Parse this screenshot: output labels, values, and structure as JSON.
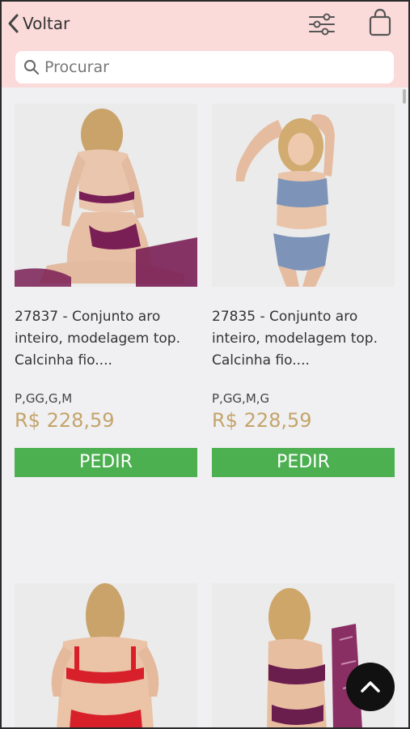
{
  "header": {
    "back_label": "Voltar",
    "filter_icon": "sliders-icon",
    "bag_icon": "shopping-bag-icon"
  },
  "search": {
    "placeholder": "Procurar",
    "icon": "search-icon"
  },
  "products": [
    {
      "title": "27837 - Conjunto aro inteiro, modelagem top. Calcinha fio....",
      "sizes": "P,GG,G,M",
      "price": "R$ 228,59",
      "button": "PEDIR",
      "color": "#7a1f55"
    },
    {
      "title": "27835 - Conjunto aro inteiro, modelagem top. Calcinha fio....",
      "sizes": "P,GG,M,G",
      "price": "R$ 228,59",
      "button": "PEDIR",
      "color": "#7d94b8"
    },
    {
      "color": "#d8202b"
    },
    {
      "color": "#6a1e4e"
    }
  ],
  "colors": {
    "header_bg": "#fbdada",
    "price": "#c4a46a",
    "button": "#4caf50",
    "page_bg": "#f0f0f2"
  },
  "scroll_top_icon": "chevron-up-icon"
}
